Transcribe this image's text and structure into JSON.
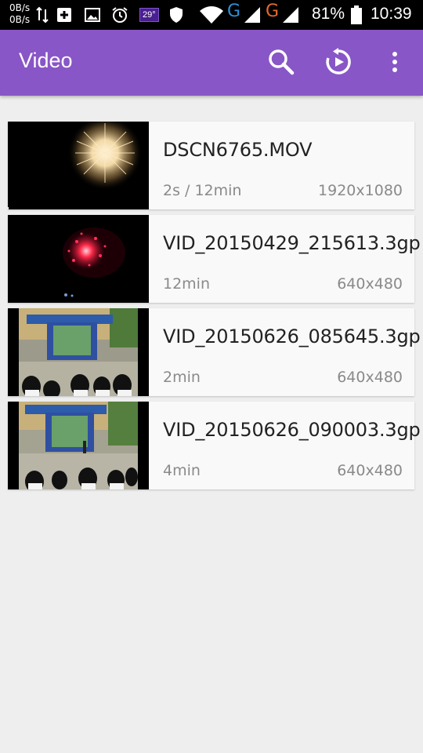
{
  "status_bar": {
    "net_up": "0B/s",
    "net_down": "0B/s",
    "temperature": "29°",
    "carrier_1": "G",
    "carrier_2": "G",
    "battery_percent": "81%",
    "time": "10:39",
    "icons": [
      "data-transfer-icon",
      "add-box-icon",
      "image-icon",
      "alarm-icon",
      "temperature-icon",
      "shield-icon",
      "wifi-icon",
      "signal-icon",
      "battery-icon"
    ]
  },
  "app_bar": {
    "title": "Video",
    "background": "#8856c6",
    "actions": [
      "search-icon",
      "resume-icon",
      "more-vert-icon"
    ]
  },
  "videos": [
    {
      "title": "DSCN6765.MOV",
      "duration": "2s / 12min",
      "resolution": "1920x1080",
      "thumb": "firework-white",
      "progress_fraction": 0.0028
    },
    {
      "title": "VID_20150429_215613.3gp",
      "duration": "12min",
      "resolution": "640x480",
      "thumb": "firework-red"
    },
    {
      "title": "VID_20150626_085645.3gp",
      "duration": "2min",
      "resolution": "640x480",
      "thumb": "school-stage"
    },
    {
      "title": "VID_20150626_090003.3gp",
      "duration": "4min",
      "resolution": "640x480",
      "thumb": "school-stage-2"
    }
  ]
}
